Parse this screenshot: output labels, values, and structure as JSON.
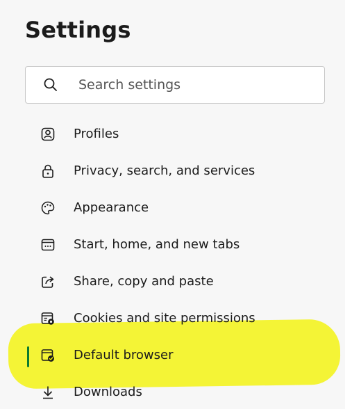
{
  "header": {
    "title": "Settings"
  },
  "search": {
    "placeholder": "Search settings",
    "icon": "search-icon"
  },
  "nav": {
    "items": [
      {
        "label": "Profiles",
        "icon": "profile-icon"
      },
      {
        "label": "Privacy, search, and services",
        "icon": "lock-icon"
      },
      {
        "label": "Appearance",
        "icon": "palette-icon"
      },
      {
        "label": "Start, home, and new tabs",
        "icon": "home-tabs-icon"
      },
      {
        "label": "Share, copy and paste",
        "icon": "share-icon"
      },
      {
        "label": "Cookies and site permissions",
        "icon": "cookies-icon"
      },
      {
        "label": "Default browser",
        "icon": "default-browser-icon",
        "active": true
      },
      {
        "label": "Downloads",
        "icon": "download-icon"
      }
    ]
  },
  "colors": {
    "active_indicator": "#0c7a2f",
    "highlight": "#f4f400",
    "panel_bg": "#f7f7f7"
  }
}
